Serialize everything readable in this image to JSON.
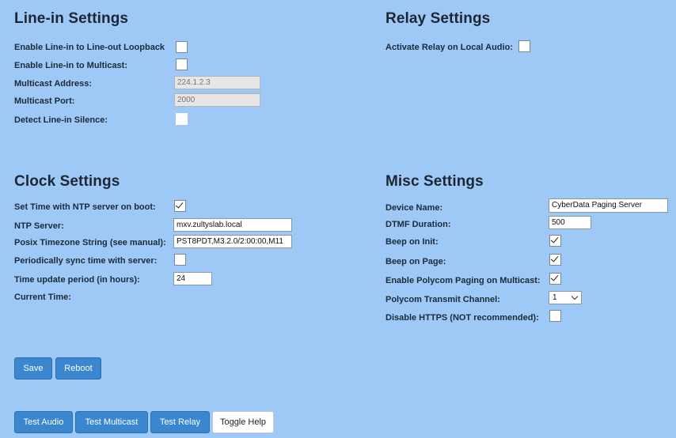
{
  "line_in": {
    "title": "Line-in Settings",
    "loopback_label": "Enable Line-in to Line-out Loopback",
    "multicast_label": "Enable Line-in to Multicast:",
    "multicast_address_label": "Multicast Address:",
    "multicast_address_value": "224.1.2.3",
    "multicast_port_label": "Multicast Port:",
    "multicast_port_value": "2000",
    "silence_label": "Detect Line-in Silence:"
  },
  "relay": {
    "title": "Relay Settings",
    "activate_label": "Activate Relay on Local Audio:"
  },
  "clock": {
    "title": "Clock Settings",
    "ntp_boot_label": "Set Time with NTP server on boot:",
    "ntp_boot_checked": true,
    "ntp_server_label": "NTP Server:",
    "ntp_server_value": "mxv.zultyslab.local",
    "posix_label": "Posix Timezone String (see manual):",
    "posix_value": "PST8PDT,M3.2.0/2:00:00,M11",
    "periodic_label": "Periodically sync time with server:",
    "period_label": "Time update period (in hours):",
    "period_value": "24",
    "current_time_label": "Current Time:"
  },
  "misc": {
    "title": "Misc Settings",
    "device_name_label": "Device Name:",
    "device_name_value": "CyberData Paging Server",
    "dtmf_label": "DTMF Duration:",
    "dtmf_value": "500",
    "beep_init_label": "Beep on Init:",
    "beep_page_label": "Beep on Page:",
    "polycom_label": "Enable Polycom Paging on Multicast:",
    "polycom_channel_label": "Polycom Transmit Channel:",
    "polycom_channel_value": "1",
    "https_label": "Disable HTTPS (NOT recommended):"
  },
  "buttons": {
    "save": "Save",
    "reboot": "Reboot",
    "test_audio": "Test Audio",
    "test_multicast": "Test Multicast",
    "test_relay": "Test Relay",
    "toggle_help": "Toggle Help"
  },
  "colors": {
    "background": "#9ec8f5",
    "button": "#3a86cf"
  }
}
